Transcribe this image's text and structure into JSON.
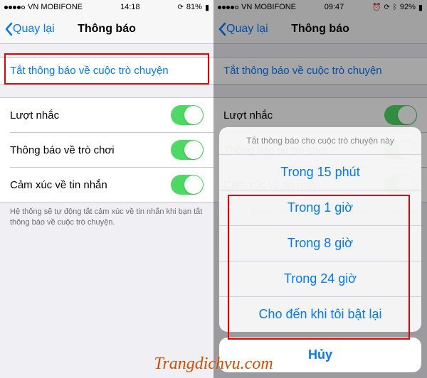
{
  "left": {
    "status": {
      "carrier": "VN MOBIFONE",
      "time": "14:18",
      "battery": "81%"
    },
    "nav": {
      "back": "Quay lại",
      "title": "Thông báo"
    },
    "muteLink": "Tắt thông báo về cuộc trò chuyện",
    "rows": {
      "reminders": "Lượt nhắc",
      "game": "Thông báo về trò chơi",
      "reactions": "Cảm xúc về tin nhắn"
    },
    "note": "Hệ thống sẽ tự động tắt cảm xúc về tin nhắn khi bạn tắt thông báo về cuộc trò chuyện."
  },
  "right": {
    "status": {
      "carrier": "VN MOBIFONE",
      "time": "09:47",
      "battery": "92%"
    },
    "nav": {
      "back": "Quay lại",
      "title": "Thông báo"
    },
    "muteLink": "Tắt thông báo về cuộc trò chuyện",
    "rows": {
      "reminders": "Lượt nhắc",
      "game": "Thông báo về trò chơi",
      "reactions": "Cảm xúc về tin nhắn"
    },
    "note": "Hệ thống sẽ tự động tắt cảm xúc về tin nhắn khi bạn tắt",
    "sheet": {
      "header": "Tắt thông báo cho cuộc trò chuyện này",
      "opt15m": "Trong 15 phút",
      "opt1h": "Trong 1 giờ",
      "opt8h": "Trong 8 giờ",
      "opt24h": "Trong 24 giờ",
      "optUntil": "Cho đến khi tôi bật lại",
      "cancel": "Hủy"
    }
  },
  "watermark": "Trangdichvu.com"
}
